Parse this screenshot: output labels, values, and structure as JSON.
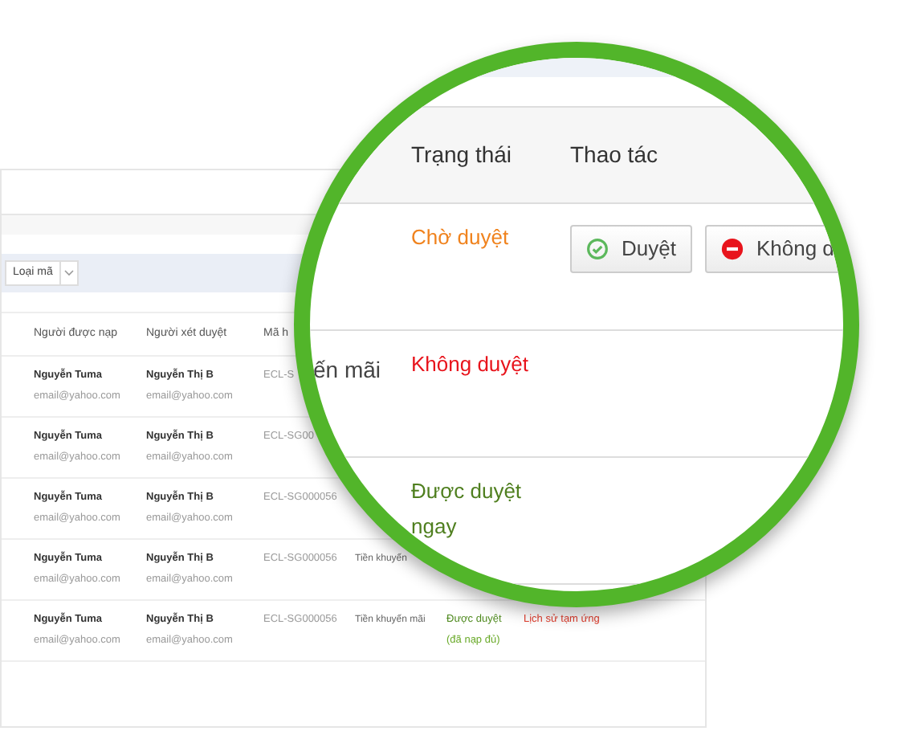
{
  "background_table": {
    "filter": {
      "label": "Loại mã"
    },
    "columns": [
      "Người được nạp",
      "Người xét duyệt",
      "Mã h"
    ],
    "rows": [
      {
        "recipient_name": "Nguyễn Tuma",
        "recipient_email": "email@yahoo.com",
        "reviewer_name": "Nguyễn Thị B",
        "reviewer_email": "email@yahoo.com",
        "code": "ECL-S"
      },
      {
        "recipient_name": "Nguyễn Tuma",
        "recipient_email": "email@yahoo.com",
        "reviewer_name": "Nguyễn Thị B",
        "reviewer_email": "email@yahoo.com",
        "code": "ECL-SG00"
      },
      {
        "recipient_name": "Nguyễn Tuma",
        "recipient_email": "email@yahoo.com",
        "reviewer_name": "Nguyễn Thị B",
        "reviewer_email": "email@yahoo.com",
        "code": "ECL-SG000056"
      },
      {
        "recipient_name": "Nguyễn Tuma",
        "recipient_email": "email@yahoo.com",
        "reviewer_name": "Nguyễn Thị B",
        "reviewer_email": "email@yahoo.com",
        "code": "ECL-SG000056",
        "type": "Tiền khuyến"
      },
      {
        "recipient_name": "Nguyễn Tuma",
        "recipient_email": "email@yahoo.com",
        "reviewer_name": "Nguyễn Thị B",
        "reviewer_email": "email@yahoo.com",
        "code": "ECL-SG000056",
        "type": "Tiền khuyến mãi",
        "status": "Được duyệt",
        "status_note": "(đã nạp đủ)",
        "action": "Lịch sử tạm ứng"
      }
    ]
  },
  "magnifier": {
    "columns": [
      "Trạng thái",
      "Thao tác"
    ],
    "rows": [
      {
        "status": "Chờ duyệt",
        "color": "#f0831e",
        "actions": [
          {
            "kind": "approve",
            "label": "Duyệt"
          },
          {
            "kind": "reject",
            "label": "Không d"
          }
        ]
      },
      {
        "type": "ến mãi",
        "status": "Không duyệt",
        "color": "#e8141c"
      },
      {
        "status": "Được duyệt ngay",
        "color": "#4f7f1f"
      }
    ]
  }
}
